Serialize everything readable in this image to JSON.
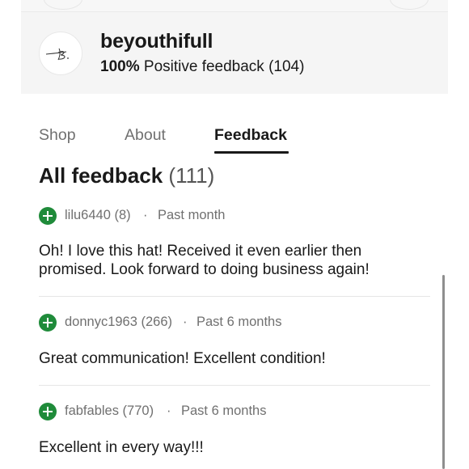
{
  "seller": {
    "avatar_label": "B.",
    "name": "beyouthifull",
    "feedback_percent": "100%",
    "feedback_text": "Positive feedback (104)"
  },
  "tabs": [
    {
      "label": "Shop",
      "active": false
    },
    {
      "label": "About",
      "active": false
    },
    {
      "label": "Feedback",
      "active": true
    }
  ],
  "feedback": {
    "heading": "All feedback",
    "count": "(111)",
    "items": [
      {
        "rating_icon": "plus-circle-icon",
        "user": "lilu6440 (8)",
        "when": "Past month",
        "comment": "Oh! I love this hat! Received it even earlier then promised. Look forward to doing business again!"
      },
      {
        "rating_icon": "plus-circle-icon",
        "user": "donnyc1963 (266)",
        "when": "Past 6 months",
        "comment": "Great communication! Excellent condition!"
      },
      {
        "rating_icon": "plus-circle-icon",
        "user": "fabfables (770)",
        "when": "Past 6 months",
        "comment": "Excellent in every way!!!"
      }
    ]
  },
  "colors": {
    "positive": "#1f8b3a",
    "text": "#191919",
    "muted": "#707070",
    "header_bg": "#f5f5f5"
  }
}
